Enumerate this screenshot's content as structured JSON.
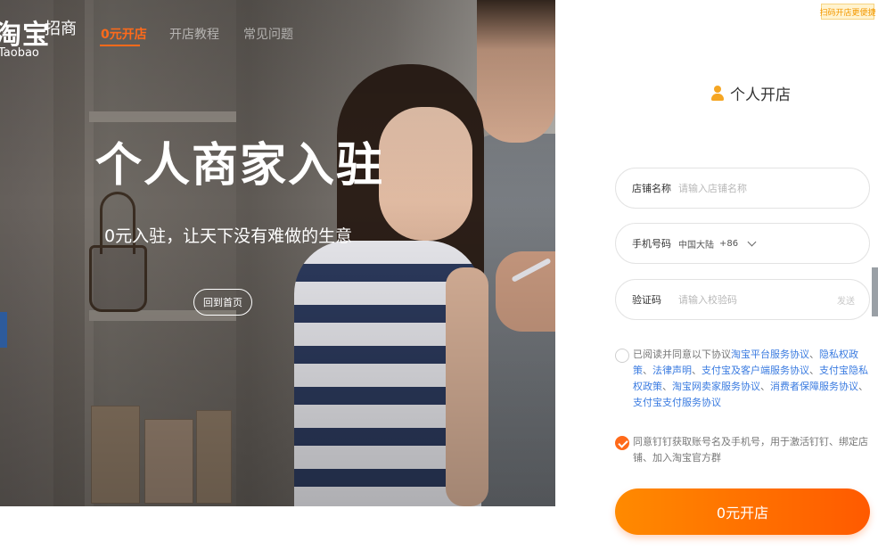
{
  "header": {
    "logo_main": "淘宝",
    "logo_sub": "Taobao",
    "logo_tag": "招商",
    "nav": [
      {
        "label": "0元开店",
        "active": true
      },
      {
        "label": "开店教程",
        "active": false
      },
      {
        "label": "常见问题",
        "active": false
      }
    ]
  },
  "hero": {
    "title": "个人商家入驻",
    "subtitle": "0元入驻，让天下没有难做的生意",
    "button_label": "回到首页"
  },
  "panel": {
    "corner_tag": "扫码开店更便捷",
    "title": "个人开店",
    "fields": {
      "shop_name": {
        "label": "店铺名称",
        "placeholder": "请输入店铺名称"
      },
      "phone": {
        "label": "手机号码",
        "region": "中国大陆",
        "code": "+86"
      },
      "verify": {
        "label": "验证码",
        "placeholder": "请输入校验码",
        "send_label": "发送"
      }
    },
    "agreement": {
      "prefix": "已阅读并同意以下协议",
      "links": [
        "淘宝平台服务协议",
        "隐私权政策",
        "法律声明",
        "支付宝及客户端服务协议",
        "支付宝隐私权政策",
        "淘宝网卖家服务协议",
        "消费者保障服务协议",
        "支付宝支付服务协议"
      ],
      "checked": false
    },
    "dingtalk": {
      "text": "同意钉钉获取账号名及手机号，用于激活钉钉、绑定店铺、加入淘宝官方群",
      "checked": true
    },
    "submit_label": "0元开店"
  },
  "colors": {
    "accent": "#ff6a1a",
    "link": "#3a7be0",
    "button_gradient_start": "#ff8a00",
    "button_gradient_end": "#ff5a00"
  },
  "icons": {
    "user": "user-icon",
    "chevron": "chevron-down-icon",
    "check": "check-icon"
  }
}
